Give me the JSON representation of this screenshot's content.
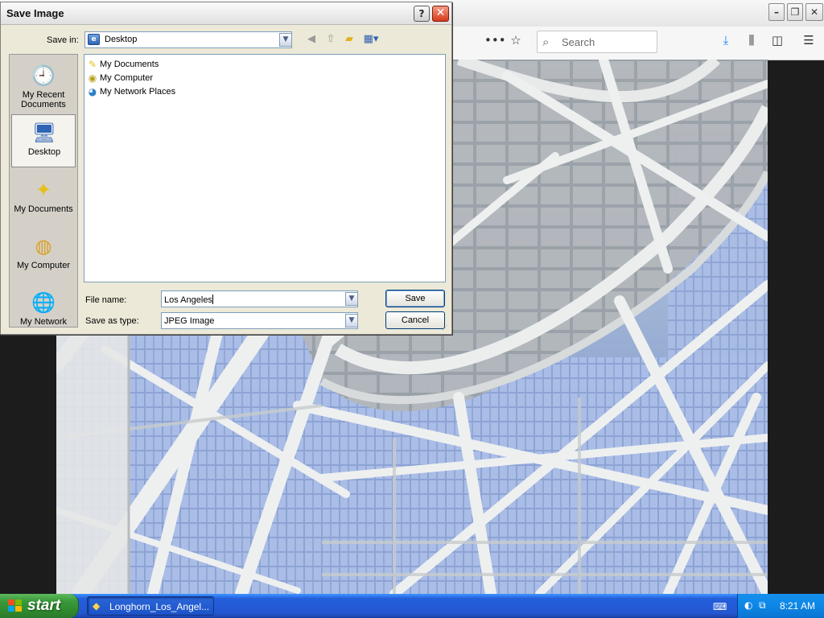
{
  "browser": {
    "search_placeholder": "Search",
    "toolbar_icons": [
      "more-icon",
      "star-icon",
      "download-icon",
      "library-icon",
      "sidebar-icon",
      "menu-icon"
    ]
  },
  "dialog": {
    "title": "Save Image",
    "help_label": "?",
    "close_label": "✕",
    "save_in_label": "Save in:",
    "save_in_value": "Desktop",
    "places": [
      {
        "label": "My Recent Documents",
        "icon": "recent-documents-icon"
      },
      {
        "label": "Desktop",
        "icon": "desktop-icon"
      },
      {
        "label": "My Documents",
        "icon": "my-documents-icon"
      },
      {
        "label": "My Computer",
        "icon": "my-computer-icon"
      },
      {
        "label": "My Network",
        "icon": "my-network-icon"
      }
    ],
    "files": [
      {
        "name": "My Documents",
        "icon": "folder-documents-icon"
      },
      {
        "name": "My Computer",
        "icon": "computer-icon"
      },
      {
        "name": "My Network Places",
        "icon": "network-icon"
      }
    ],
    "file_name_label": "File name:",
    "file_name_value": "Los Angeles",
    "save_type_label": "Save as type:",
    "save_type_value": "JPEG Image",
    "save_button": "Save",
    "cancel_button": "Cancel"
  },
  "taskbar": {
    "start_label": "start",
    "task_item": "Longhorn_Los_Angel...",
    "clock": "8:21 AM"
  }
}
